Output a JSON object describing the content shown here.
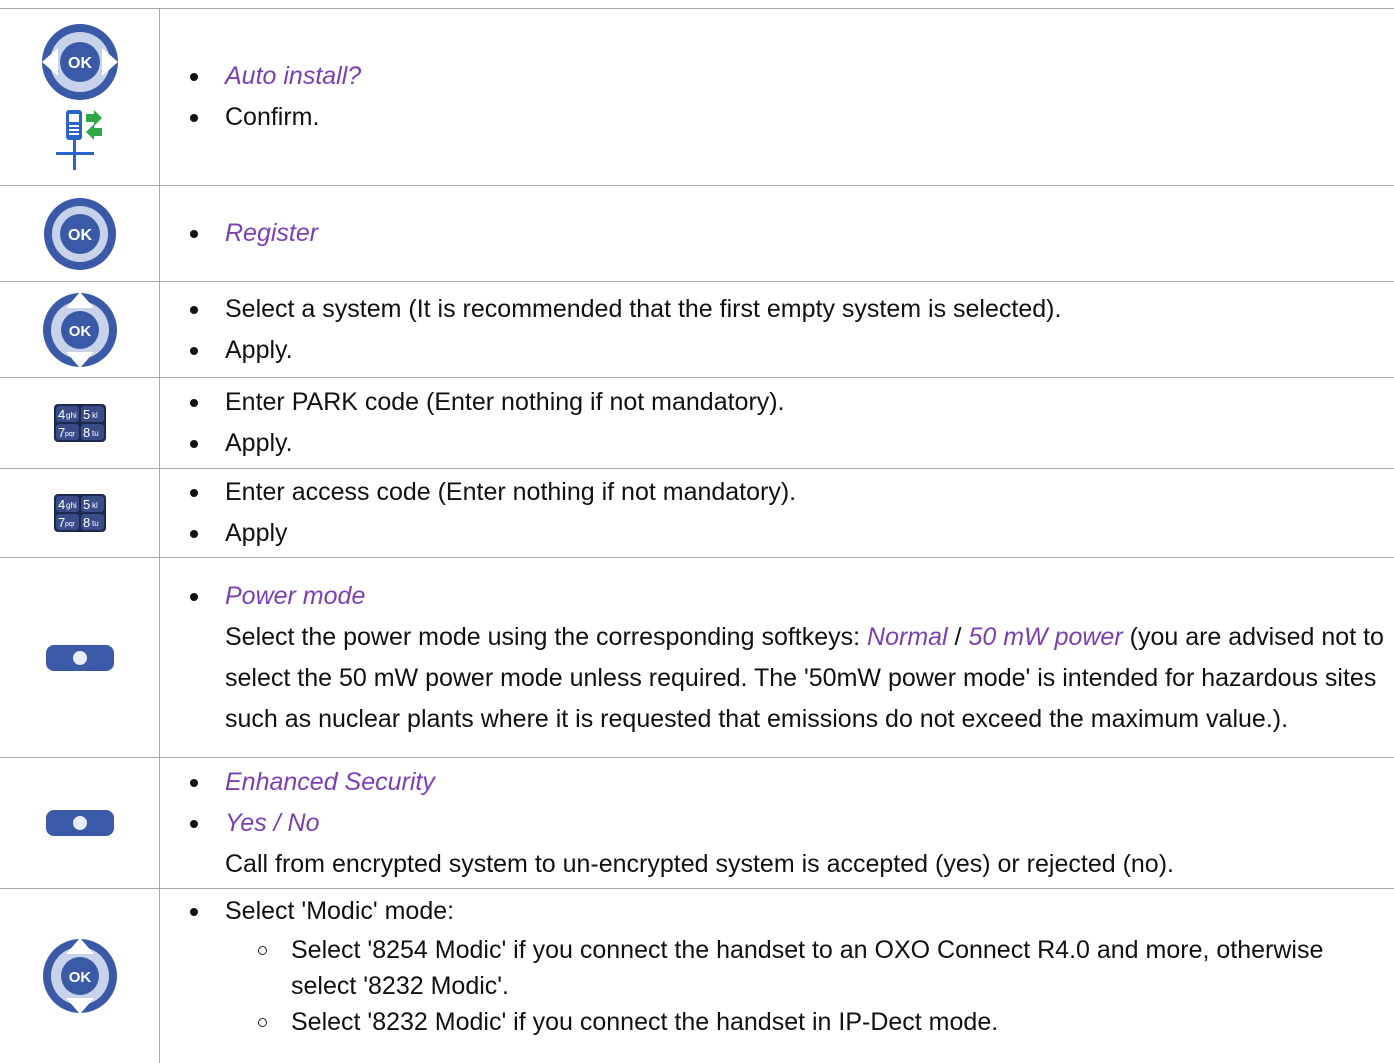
{
  "icons": {
    "ok_left_right": "ok-left-right-nav-icon",
    "handset_install": "handset-install-icon",
    "ok_button": "ok-button-icon",
    "ok_up_down": "ok-up-down-nav-icon",
    "keypad": "keypad-keys-icon",
    "softkey": "softkey-icon"
  },
  "ok_label": "OK",
  "keypad_keys": [
    "4",
    "ghi",
    "5",
    "kl",
    "7",
    "pqr",
    "8",
    "tu"
  ],
  "colors": {
    "accent_italic": "#7b3fb5",
    "icon_blue": "#3a5aa8",
    "icon_dark": "#243a78",
    "border": "#a8a8a8"
  },
  "rows": [
    {
      "items": [
        "Auto install?",
        "Confirm."
      ]
    },
    {
      "items": [
        "Register"
      ]
    },
    {
      "items": [
        "Select a system (It is recommended that the first empty system is selected).",
        "Apply."
      ]
    },
    {
      "items": [
        "Enter PARK code (Enter nothing if not mandatory).",
        "Apply."
      ]
    },
    {
      "items": [
        "Enter access code (Enter nothing if not mandatory).",
        "Apply"
      ]
    },
    {
      "item": "Power mode",
      "p_before": "Select the power mode using the corresponding softkeys: ",
      "opt1": "Normal",
      "sep": " / ",
      "opt2": "50 mW power",
      "p_after": " (you are advised not to select the 50 mW power mode unless required. The '50mW power mode' is intended for hazardous sites such as nuclear plants where it is requested that emissions do not exceed the maximum value.)."
    },
    {
      "items": [
        "Enhanced Security",
        "Yes / No"
      ],
      "para": "Call from encrypted system to un-encrypted system is accepted (yes) or rejected (no)."
    },
    {
      "item": "Select 'Modic' mode:",
      "subitems": [
        "Select '8254 Modic' if you connect the handset to an OXO Connect R4.0 and more, otherwise select '8232 Modic'.",
        "Select '8232 Modic' if you connect the handset in IP-Dect mode."
      ]
    }
  ]
}
